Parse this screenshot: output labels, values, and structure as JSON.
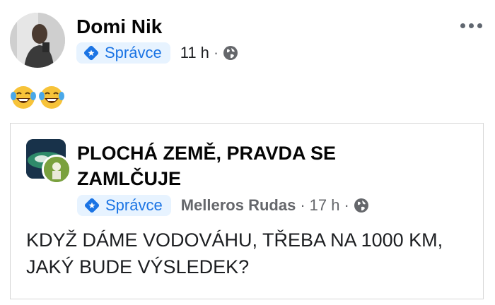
{
  "post": {
    "author": "Domi Nik",
    "role_badge": "Správce",
    "time": "11 h",
    "separator": "·",
    "body_emoji": [
      "laughing-crying-emoji",
      "laughing-crying-emoji"
    ]
  },
  "shared_post": {
    "group_name": "PLOCHÁ ZEMĚ, PRAVDA SE ZAMLČUJE",
    "role_badge": "Správce",
    "poster": "Melleros Rudas",
    "separator": "·",
    "time": "17 h",
    "text": "KDYŽ DÁME VODOVÁHU, TŘEBA NA 1000 KM, JAKÝ BUDE VÝSLEDEK?"
  },
  "colors": {
    "badge_bg": "#e7f3ff",
    "badge_text": "#1b74e4",
    "secondary_text": "#65676b",
    "border": "#d6d6d6"
  },
  "icons": [
    "more-horizontal-icon",
    "globe-icon",
    "admin-star-icon"
  ]
}
